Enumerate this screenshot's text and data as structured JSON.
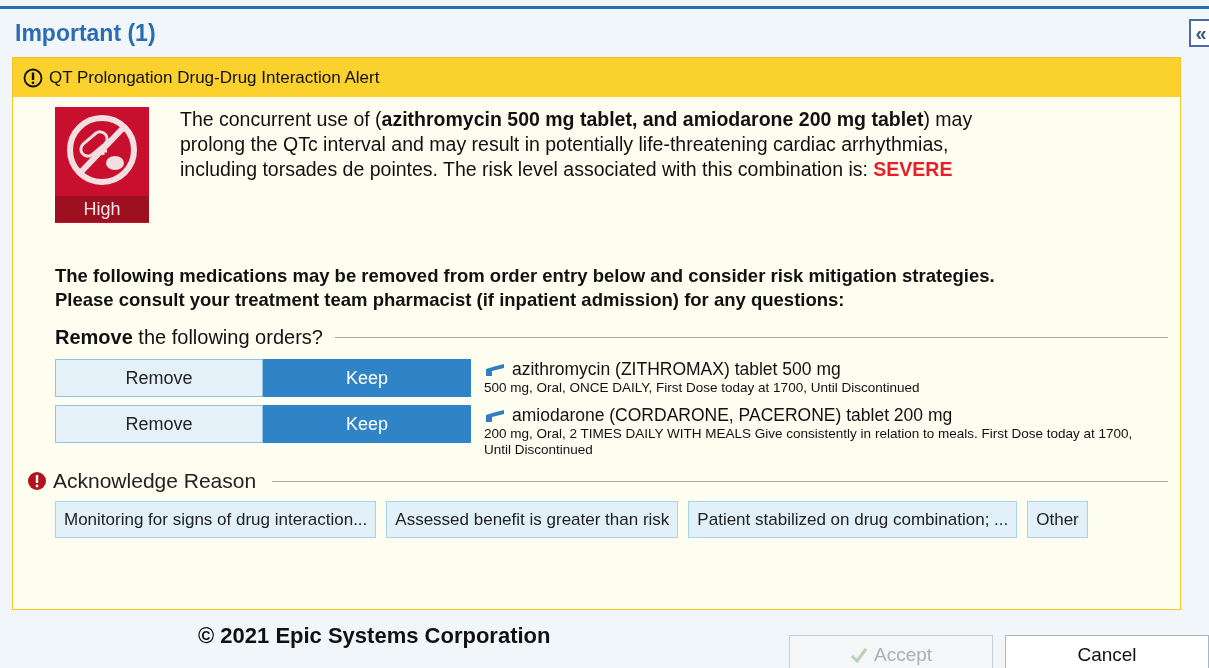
{
  "section": {
    "title": "Important (1)",
    "collapse_button": "«"
  },
  "alert": {
    "title": "QT Prolongation Drug-Drug Interaction Alert",
    "badge": "High",
    "message": "The concurrent use of (**azithromycin 500 mg tablet, and amiodarone 200 mg tablet**) may prolong the QTc interval and may result in potentially life-threatening cardiac arrhythmias, including torsades de pointes.  The risk level associated with this combination is:",
    "severity": "SEVERE",
    "instructions": [
      "The following medications may be removed from order entry below and consider risk mitigation strategies.",
      "Please consult your treatment team pharmacist (if inpatient admission) for any questions:"
    ],
    "remove_heading": "**Remove** the following orders?",
    "orders": [
      {
        "name": "azithromycin (ZITHROMAX) tablet 500 mg",
        "details": "500 mg, Oral, ONCE DAILY, First Dose today at 1700, Until Discontinued",
        "options": [
          {
            "label": "Remove",
            "selected": false
          },
          {
            "label": "Keep",
            "selected": true
          }
        ]
      },
      {
        "name": "amiodarone (CORDARONE, PACERONE) tablet 200 mg",
        "details": "200 mg, Oral, 2 TIMES DAILY WITH MEALS Give consistently in relation to meals. First Dose today at 1700, Until Discontinued",
        "options": [
          {
            "label": "Remove",
            "selected": false
          },
          {
            "label": "Keep",
            "selected": true
          }
        ]
      }
    ],
    "acknowledge": {
      "heading": "Acknowledge Reason",
      "required": true,
      "reasons": [
        {
          "label": "Monitoring for signs of drug interaction...",
          "selected": false
        },
        {
          "label": "Assessed benefit is greater than risk",
          "selected": false
        },
        {
          "label": "Patient stabilized on drug combination; ...",
          "selected": false
        },
        {
          "label": "Other",
          "selected": false
        }
      ]
    }
  },
  "copyright": "© 2021 Epic Systems Corporation",
  "buttons": [
    {
      "label": "Accept",
      "kind": "accept",
      "disabled": true
    },
    {
      "label": "Cancel",
      "kind": "cancel",
      "disabled": false
    }
  ]
}
